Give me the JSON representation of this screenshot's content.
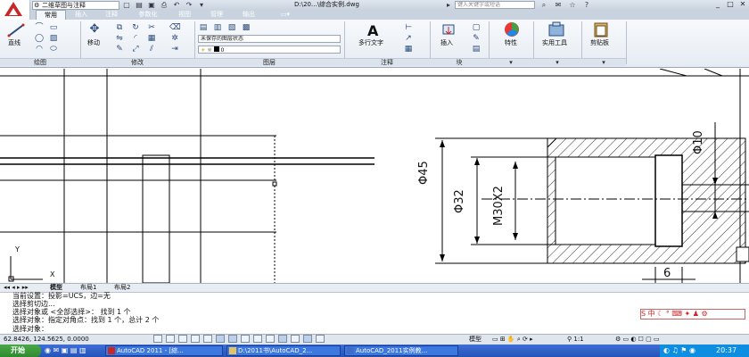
{
  "titlebar": {
    "workspace": "二维草图与注释",
    "doc_title": "D:\\20...\\综合实例.dwg",
    "help_search_placeholder": "键入关键字或短语"
  },
  "tabs": [
    "常用",
    "插入",
    "注释",
    "参数化",
    "视图",
    "管理",
    "输出"
  ],
  "ribbon": {
    "draw": {
      "big_label": "直线",
      "title": "绘图"
    },
    "modify": {
      "big_label": "移动",
      "title": "修改"
    },
    "layers": {
      "state": "未保存的图层状态",
      "current": "0",
      "title": "图层"
    },
    "annotation": {
      "big_label": "多行文字",
      "title": "注释"
    },
    "block": {
      "big_label": "插入",
      "title": "块"
    },
    "properties": {
      "big_label": "特性"
    },
    "utilities": {
      "big_label": "实用工具"
    },
    "clipboard": {
      "big_label": "剪贴板"
    }
  },
  "drawing": {
    "dims": [
      "Φ45",
      "Φ32",
      "M30X2",
      "Φ10",
      "6"
    ],
    "ucs": {
      "x": "X",
      "y": "Y"
    }
  },
  "layout_tabs": [
    "模型",
    "布局1",
    "布局2"
  ],
  "command_lines": [
    "当前设置：投影=UCS，边=无",
    "选择剪切边...",
    "选择对象或 <全部选择>：  找到 1 个",
    "选择对象：指定对角点：找到 1 个，总计 2 个",
    "选择对象："
  ],
  "statusbar": {
    "coords": "62.8426, 124.5625, 0.0000",
    "model_label": "模型",
    "scale": "1:1"
  },
  "taskbar": {
    "start": "开始",
    "tasks": [
      "AutoCAD 2011 - [綜...",
      "D:\\2011书\\AutoCAD_2...",
      "AutoCAD_2011实例教..."
    ],
    "clock": "20:37"
  },
  "colors": {
    "accent": "#c62828",
    "ribbon_bg": "#e6ecf3",
    "taskbar": "#2453b8"
  }
}
